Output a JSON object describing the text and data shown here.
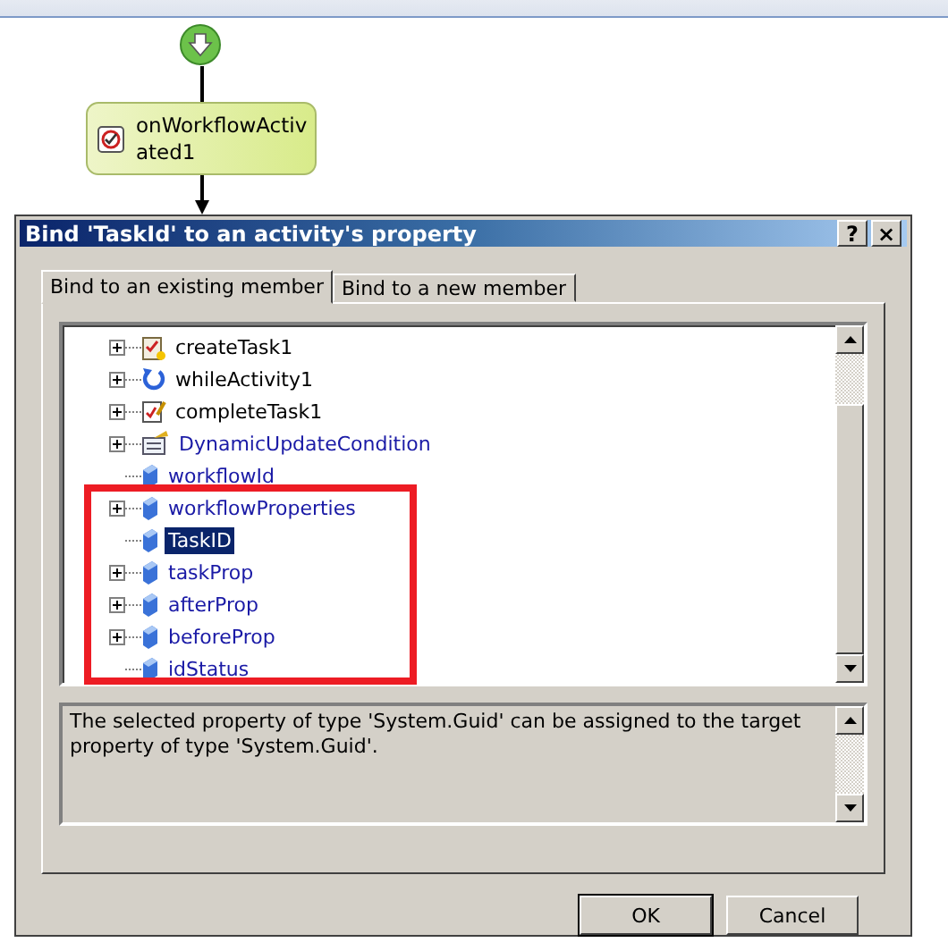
{
  "workflow": {
    "activity": "onWorkflowActivated1"
  },
  "dialog": {
    "title": "Bind 'TaskId' to an activity's property",
    "help": "?",
    "close": "×",
    "tabs": [
      {
        "label": "Bind to an existing member",
        "selected": true
      },
      {
        "label": "Bind to a new member",
        "selected": false
      }
    ],
    "tree": [
      {
        "label": "createTask1",
        "kind": "task",
        "expandable": true,
        "selected": false
      },
      {
        "label": "whileActivity1",
        "kind": "loop",
        "expandable": true,
        "selected": false
      },
      {
        "label": "completeTask1",
        "kind": "edit",
        "expandable": true,
        "selected": false
      },
      {
        "label": "DynamicUpdateCondition",
        "kind": "condition",
        "expandable": true,
        "selected": false
      },
      {
        "label": "workflowId",
        "kind": "property",
        "expandable": false,
        "selected": false
      },
      {
        "label": "workflowProperties",
        "kind": "property",
        "expandable": true,
        "selected": false
      },
      {
        "label": "TaskID",
        "kind": "property",
        "expandable": false,
        "selected": true
      },
      {
        "label": "taskProp",
        "kind": "property",
        "expandable": true,
        "selected": false
      },
      {
        "label": "afterProp",
        "kind": "property",
        "expandable": true,
        "selected": false
      },
      {
        "label": "beforeProp",
        "kind": "property",
        "expandable": true,
        "selected": false
      },
      {
        "label": "idStatus",
        "kind": "property",
        "expandable": false,
        "selected": false
      }
    ],
    "description": "The selected property of type 'System.Guid' can be assigned to the target property of type 'System.Guid'.",
    "buttons": [
      "OK",
      "Cancel"
    ]
  }
}
